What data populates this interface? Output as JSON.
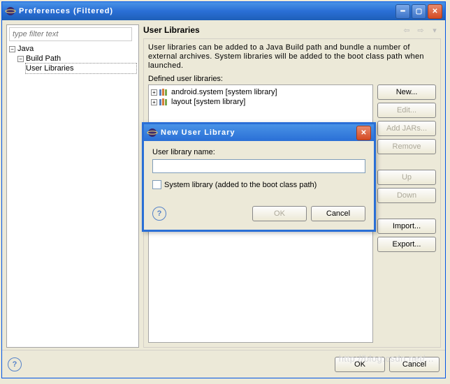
{
  "window": {
    "title": "Preferences (Filtered)"
  },
  "sidebar": {
    "filter_placeholder": "type filter text",
    "tree": {
      "java": "Java",
      "build_path": "Build Path",
      "user_libraries": "User Libraries"
    }
  },
  "content": {
    "title": "User Libraries",
    "description": "User libraries can be added to a Java Build path and bundle a number of external archives. System libraries will be added to the boot class path when launched.",
    "defined_label": "Defined user libraries:",
    "libs": [
      {
        "label": "android.system [system library]"
      },
      {
        "label": "layout [system library]"
      }
    ],
    "buttons": {
      "new": "New...",
      "edit": "Edit...",
      "add_jars": "Add JARs...",
      "remove": "Remove",
      "up": "Up",
      "down": "Down",
      "import": "Import...",
      "export": "Export..."
    }
  },
  "footer": {
    "ok": "OK",
    "cancel": "Cancel"
  },
  "modal": {
    "title": "New User Library",
    "name_label": "User library name:",
    "name_value": "",
    "syslib_label": "System library (added to the boot class path)",
    "ok": "OK",
    "cancel": "Cancel"
  },
  "watermark": "http://blog.csdn.net/..."
}
